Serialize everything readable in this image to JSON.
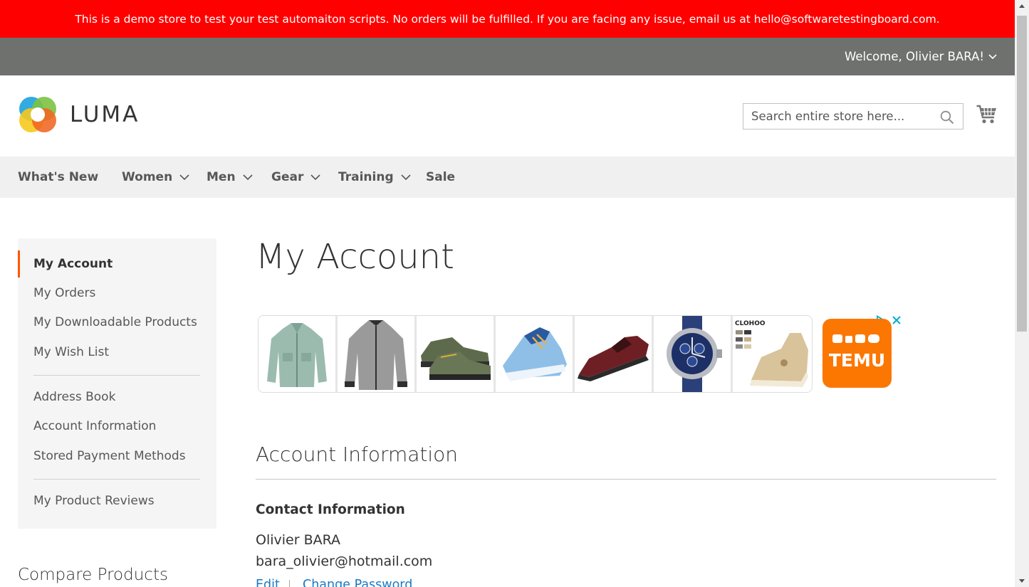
{
  "banner": {
    "text": "This is a demo store to test your test automaiton scripts. No orders will be fulfilled. If you are facing any issue, email us at hello@softwaretestingboard.com."
  },
  "header": {
    "welcome": "Welcome, Olivier BARA!",
    "logo_text": "LUMA",
    "search_placeholder": "Search entire store here...",
    "search_icon": "magnifier-icon",
    "cart_icon": "shopping-cart-icon"
  },
  "nav": {
    "items": [
      {
        "label": "What's New",
        "has_dropdown": false
      },
      {
        "label": "Women",
        "has_dropdown": true
      },
      {
        "label": "Men",
        "has_dropdown": true
      },
      {
        "label": "Gear",
        "has_dropdown": true
      },
      {
        "label": "Training",
        "has_dropdown": true
      },
      {
        "label": "Sale",
        "has_dropdown": false
      }
    ]
  },
  "sidebar": {
    "items": [
      {
        "label": "My Account",
        "current": true
      },
      {
        "label": "My Orders"
      },
      {
        "label": "My Downloadable Products"
      },
      {
        "label": "My Wish List"
      },
      {
        "label": "Address Book"
      },
      {
        "label": "Account Information"
      },
      {
        "label": "Stored Payment Methods"
      },
      {
        "label": "My Product Reviews"
      }
    ],
    "compare_title": "Compare Products"
  },
  "main": {
    "page_title": "My Account",
    "ad": {
      "products": [
        "green-jacket",
        "gray-bomber-jacket",
        "hiking-shoes",
        "blue-sneakers",
        "burgundy-dress-shoes",
        "chronograph-watch",
        "beige-casual-shoes"
      ],
      "tile_brand_text": "CLOHOO",
      "advertiser": "TEMU",
      "accent_color": "#fb7701"
    },
    "account_info_title": "Account Information",
    "contact_title": "Contact Information",
    "contact_name": "Olivier BARA",
    "contact_email": "bara_olivier@hotmail.com",
    "edit_label": "Edit",
    "change_password_label": "Change Password"
  },
  "colors": {
    "banner": "#ff0000",
    "panel": "#6e716e",
    "nav_bg": "#f0f0f0",
    "sidebar_bg": "#f5f5f5",
    "current_marker": "#ff5501",
    "link": "#1979c3"
  }
}
